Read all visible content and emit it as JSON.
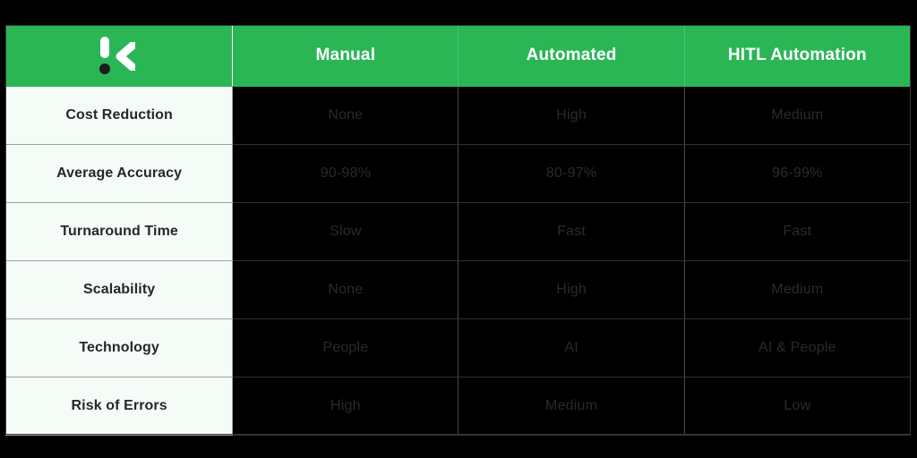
{
  "brand": {
    "logo_icon": "kodiak-k-logo-icon",
    "logo_color": "#FFFFFF",
    "header_bg": "#2BB656"
  },
  "colors": {
    "accent_green": "#2BB656",
    "label_bg": "#F5FBF7",
    "label_text": "#23292B",
    "data_bg": "#000000",
    "data_text": "#2A2A2A",
    "header_text": "#FFFFFF",
    "page_bg": "#000000"
  },
  "table": {
    "corner_label": "",
    "columns": [
      {
        "label": "Manual"
      },
      {
        "label": "Automated"
      },
      {
        "label": "HITL Automation"
      }
    ],
    "rows": [
      {
        "label": "Cost Reduction",
        "values": [
          "None",
          "High",
          "Medium"
        ]
      },
      {
        "label": "Average Accuracy",
        "values": [
          "90-98%",
          "80-97%",
          "96-99%"
        ]
      },
      {
        "label": "Turnaround Time",
        "values": [
          "Slow",
          "Fast",
          "Fast"
        ]
      },
      {
        "label": "Scalability",
        "values": [
          "None",
          "High",
          "Medium"
        ]
      },
      {
        "label": "Technology",
        "values": [
          "People",
          "AI",
          "AI & People"
        ]
      },
      {
        "label": "Risk of Errors",
        "values": [
          "High",
          "Medium",
          "Low"
        ]
      }
    ]
  }
}
